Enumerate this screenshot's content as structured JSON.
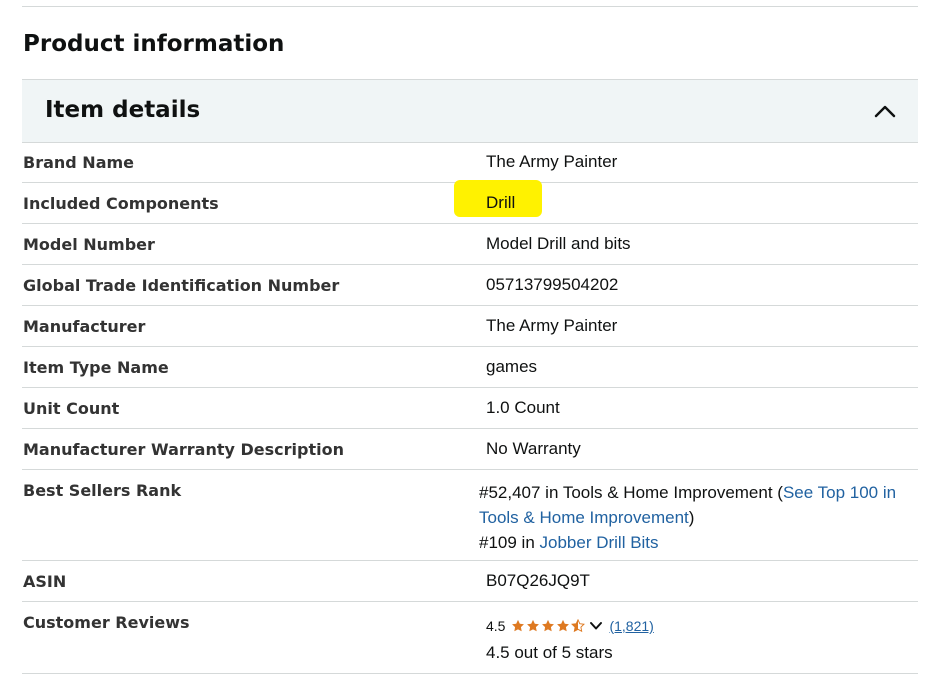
{
  "page_title": "Product information",
  "section": {
    "title": "Item details",
    "expanded": true
  },
  "rows": [
    {
      "label": "Brand Name",
      "value": "The Army Painter"
    },
    {
      "label": "Included Components",
      "value": "Drill"
    },
    {
      "label": "Model Number",
      "value": "Model Drill and bits"
    },
    {
      "label": "Global Trade Identification Number",
      "value": "05713799504202"
    },
    {
      "label": "Manufacturer",
      "value": "The Army Painter"
    },
    {
      "label": "Item Type Name",
      "value": "games"
    },
    {
      "label": "Unit Count",
      "value": "1.0 Count"
    },
    {
      "label": "Manufacturer Warranty Description",
      "value": "No Warranty"
    }
  ],
  "best_sellers": {
    "label": "Best Sellers Rank",
    "rank1_text": "#52,407 in Tools & Home Improvement (",
    "rank1_link": "See Top 100 in Tools & Home Improvement",
    "rank1_close": ")",
    "rank2_text": "#109 in ",
    "rank2_link": "Jobber Drill Bits"
  },
  "asin": {
    "label": "ASIN",
    "value": "B07Q26JQ9T"
  },
  "reviews": {
    "label": "Customer Reviews",
    "rating": "4.5",
    "rating_value": 4.5,
    "count_text": "(1,821)",
    "stars_text": "4.5 out of 5 stars"
  },
  "colors": {
    "highlight": "#fff200",
    "link": "#2162a1",
    "star": "#de7921",
    "header_bg": "#f0f5f6",
    "divider": "#d5d9d9"
  },
  "icons": {
    "collapse": "chevron-up-icon",
    "star": "star-icon",
    "half_star": "half-star-icon",
    "dropdown": "chevron-down-icon"
  }
}
